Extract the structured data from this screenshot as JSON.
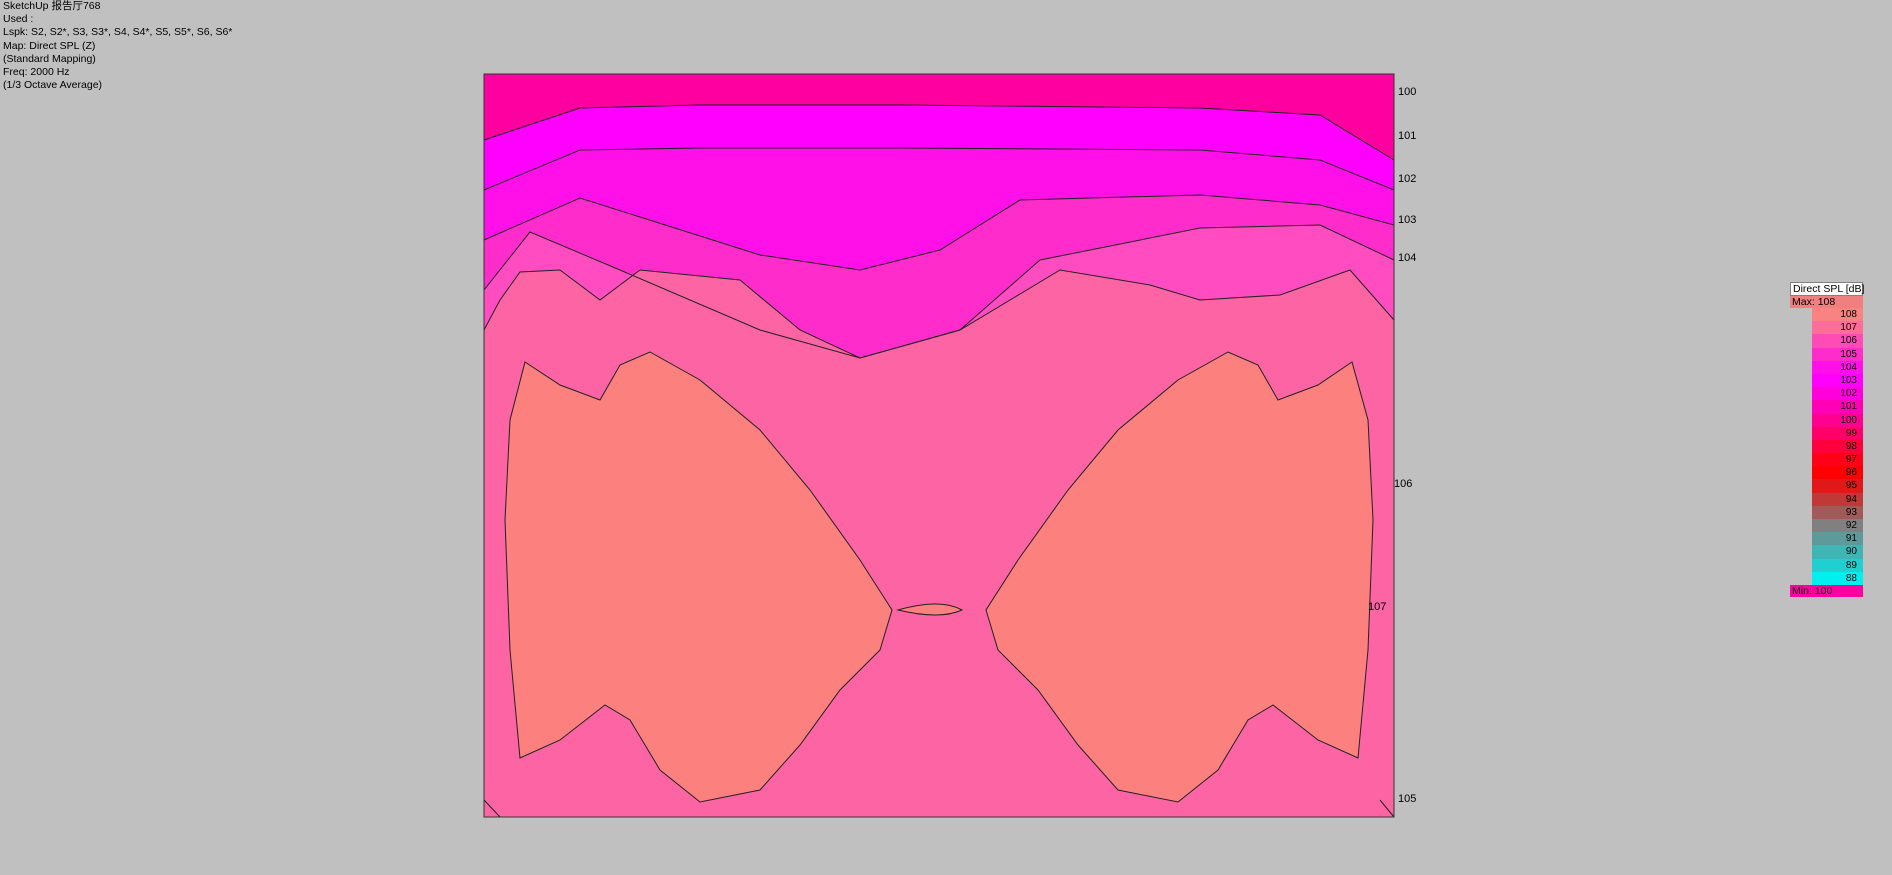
{
  "header": {
    "lines": [
      "SketchUp 报告厅768",
      "Used :",
      "Lspk: S2, S2*, S3, S3*, S4, S4*, S5, S5*, S6, S6*",
      "Map: Direct SPL (Z)",
      "(Standard Mapping)",
      "Freq: 2000 Hz",
      "(1/3 Octave Average)"
    ]
  },
  "legend": {
    "title": "Direct SPL [dB]",
    "max_label": "Max:",
    "max_value": "108",
    "min_label": "Min:",
    "min_value": "100",
    "max_color": "#f08080",
    "min_color": "#ff00a0",
    "entries": [
      {
        "label": "108",
        "color": "#f98282"
      },
      {
        "label": "107",
        "color": "#fc6d9a"
      },
      {
        "label": "106",
        "color": "#fe4bb5"
      },
      {
        "label": "105",
        "color": "#ff2ccc"
      },
      {
        "label": "104",
        "color": "#ff10e8"
      },
      {
        "label": "103",
        "color": "#ff00ff"
      },
      {
        "label": "102",
        "color": "#ff00dd"
      },
      {
        "label": "101",
        "color": "#ff00b7"
      },
      {
        "label": "100",
        "color": "#ff0090"
      },
      {
        "label": "99",
        "color": "#ff0068"
      },
      {
        "label": "98",
        "color": "#ff003f"
      },
      {
        "label": "97",
        "color": "#ff0018"
      },
      {
        "label": "96",
        "color": "#ff0000"
      },
      {
        "label": "95",
        "color": "#e01818"
      },
      {
        "label": "94",
        "color": "#c03838"
      },
      {
        "label": "93",
        "color": "#a05a5a"
      },
      {
        "label": "92",
        "color": "#808080"
      },
      {
        "label": "91",
        "color": "#5f9a9a"
      },
      {
        "label": "90",
        "color": "#3fb5b5"
      },
      {
        "label": "89",
        "color": "#20d0d0"
      },
      {
        "label": "88",
        "color": "#00f0f0"
      }
    ]
  },
  "chart_data": {
    "type": "heatmap",
    "title": "Direct SPL [dB]",
    "frequency": "2000 Hz",
    "range": [
      100,
      108
    ],
    "contour_labels": [
      {
        "value": "100",
        "color": "#ff00a0"
      },
      {
        "value": "101",
        "color": "#ff10e0"
      },
      {
        "value": "102",
        "color": "#ff00ff"
      },
      {
        "value": "103",
        "color": "#ff20e8"
      },
      {
        "value": "104",
        "color": "#ff40d0"
      },
      {
        "value": "106",
        "color": "#ff66a0"
      },
      {
        "value": "107",
        "color": "#ff8080"
      },
      {
        "value": "105",
        "color": "#ff4cc0"
      }
    ]
  }
}
